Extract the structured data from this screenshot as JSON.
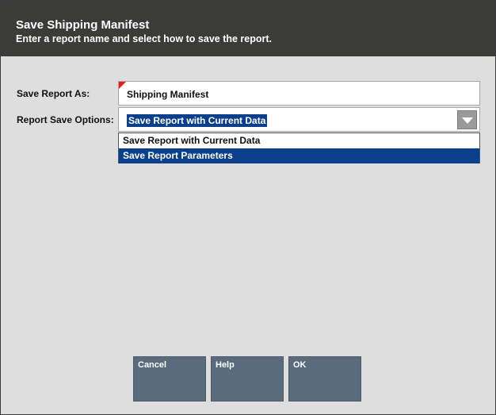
{
  "dialog": {
    "title": "Save Shipping Manifest",
    "subtitle": "Enter a report name and select how to save the report."
  },
  "form": {
    "report_name_label": "Save Report As:",
    "report_name_value": "Shipping Manifest",
    "save_options_label": "Report Save Options:",
    "save_options_selected": "Save Report with Current Data",
    "save_options": [
      "Save Report with Current Data",
      "Save Report Parameters"
    ],
    "highlighted_option_index": 1
  },
  "buttons": {
    "cancel": "Cancel",
    "help": "Help",
    "ok": "OK"
  },
  "colors": {
    "header_bg": "#3b3b39",
    "selection": "#0b3f8c",
    "button_bg": "#5a6b7e",
    "required_marker": "#e02020"
  }
}
